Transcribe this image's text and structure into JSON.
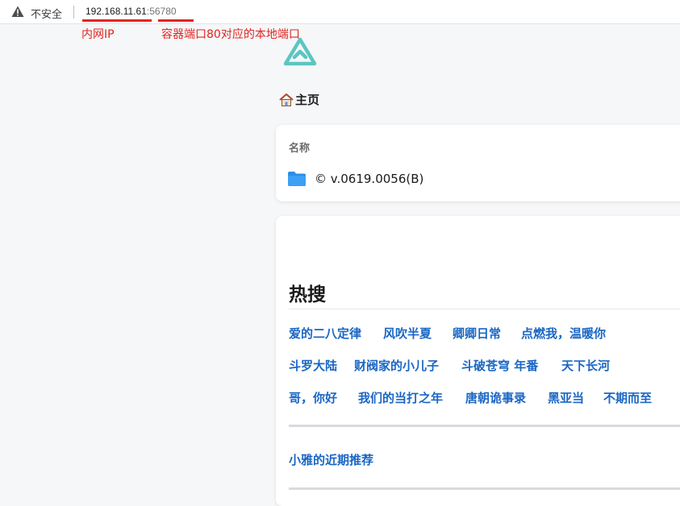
{
  "address_bar": {
    "security_label": "不安全",
    "url_host": "192.168.11.61",
    "url_port": ":56780"
  },
  "annotations": {
    "ip_label": "内网IP",
    "port_label": "容器端口80对应的本地端口",
    "color": "#e0251f"
  },
  "breadcrumb": {
    "home_label": "主页"
  },
  "file_list": {
    "column_header": "名称",
    "items": [
      {
        "name": "© v.0619.0056(B)",
        "icon": "folder-icon"
      }
    ]
  },
  "hot_search": {
    "title": "热搜",
    "rows": [
      [
        "爱的二八定律",
        "风吹半夏",
        "卿卿日常",
        "点燃我，温暖你"
      ],
      [
        "斗罗大陆",
        "财阀家的小儿子",
        "斗破苍穹 年番",
        "天下长河"
      ],
      [
        "哥，你好",
        "我们的当打之年",
        "唐朝诡事录",
        "黑亚当",
        "不期而至"
      ]
    ],
    "recent_label": "小雅的近期推荐"
  },
  "colors": {
    "link": "#1a66c4",
    "folder": "#2a8fe6",
    "logo": "#5cc6c0"
  }
}
